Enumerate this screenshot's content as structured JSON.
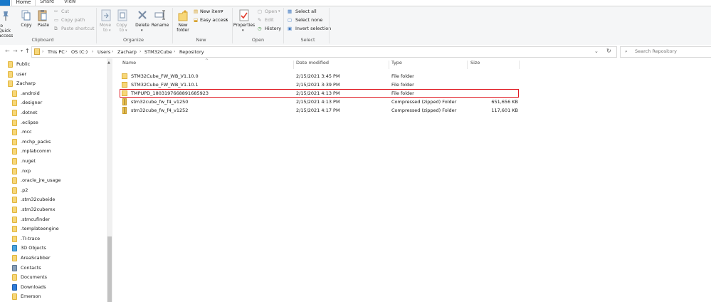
{
  "tabs": {
    "file": "",
    "home": "Home",
    "share": "Share",
    "view": "View"
  },
  "ribbon": {
    "clipboard": {
      "pin_label": "to Quick access",
      "copy": "Copy",
      "paste": "Paste",
      "cut": "Cut",
      "copy_path": "Copy path",
      "paste_shortcut": "Paste shortcut",
      "group": "Clipboard"
    },
    "organize": {
      "move_to": "Move to",
      "copy_to": "Copy to",
      "delete": "Delete",
      "rename": "Rename",
      "group": "Organize"
    },
    "new": {
      "new_folder": "New folder",
      "new_item": "New item",
      "easy_access": "Easy access",
      "group": "New"
    },
    "open": {
      "properties": "Properties",
      "open": "Open",
      "edit": "Edit",
      "history": "History",
      "group": "Open"
    },
    "select": {
      "select_all": "Select all",
      "select_none": "Select none",
      "invert": "Invert selection",
      "group": "Select"
    }
  },
  "address": {
    "crumbs": [
      "This PC",
      "OS (C:)",
      "Users",
      "Zacharp",
      "STM32Cube",
      "Repository"
    ],
    "search_placeholder": "Search Repository"
  },
  "sidebar": {
    "items": [
      "Public",
      "user",
      "Zacharp",
      ".android",
      ".designer",
      ".dotnet",
      ".eclipse",
      ".mcc",
      ".mchp_packs",
      ".mplabcomm",
      ".nuget",
      ".nxp",
      ".oracle_jre_usage",
      ".p2",
      ".stm32cubeide",
      ".stm32cubemx",
      ".stmcufinder",
      ".templateengine",
      ".TI-trace",
      "3D Objects",
      "AreaScabber",
      "Contacts",
      "Documents",
      "Downloads",
      "Emerson"
    ]
  },
  "columns": {
    "name": "Name",
    "date": "Date modified",
    "type": "Type",
    "size": "Size"
  },
  "files": [
    {
      "name": "STM32Cube_FW_WB_V1.10.0",
      "date": "2/15/2021 3:45 PM",
      "type": "File folder",
      "size": ""
    },
    {
      "name": "STM32Cube_FW_WB_V1.10.1",
      "date": "2/15/2021 3:39 PM",
      "type": "File folder",
      "size": ""
    },
    {
      "name": "TMPUPD_1803197668891685923",
      "date": "2/15/2021 4:13 PM",
      "type": "File folder",
      "size": ""
    },
    {
      "name": "stm32cube_fw_f4_v1250",
      "date": "2/15/2021 4:13 PM",
      "type": "Compressed (zipped) Folder",
      "size": "651,656 KB"
    },
    {
      "name": "stm32cube_fw_f4_v1252",
      "date": "2/15/2021 4:17 PM",
      "type": "Compressed (zipped) Folder",
      "size": "117,601 KB"
    }
  ],
  "colors": {
    "accent": "#1979ca",
    "highlight": "#e01b24",
    "folder": "#f7d779"
  }
}
